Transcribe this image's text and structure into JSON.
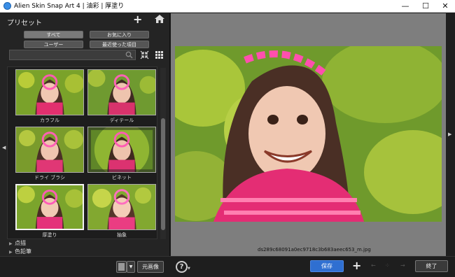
{
  "window": {
    "title": "Alien Skin Snap Art 4 | 油彩 | 厚塗り",
    "minimize": "—",
    "maximize": "☐",
    "close": "✕"
  },
  "presets": {
    "header": "プリセット",
    "add": "+",
    "filters": {
      "all": "すべて",
      "favorites": "お気に入り",
      "user": "ユーザー",
      "recent": "最近使った項目"
    },
    "search_placeholder": "",
    "items": [
      {
        "label": "カラフル"
      },
      {
        "label": "ディテール"
      },
      {
        "label": "ドライ ブラシ"
      },
      {
        "label": "ビネット"
      },
      {
        "label": "厚塗り"
      },
      {
        "label": "抽象"
      }
    ],
    "categories": [
      {
        "label": "点描"
      },
      {
        "label": "色鉛筆"
      }
    ]
  },
  "preview": {
    "filename": "ds289c68091a0ec9718c3b683aeec653_m.jpg"
  },
  "bottom": {
    "original_image": "元画像",
    "help": "?",
    "save": "保存",
    "plus": "+",
    "finish": "終了"
  },
  "colors": {
    "accent": "#2f6fd1",
    "panel": "#242424",
    "preview_bg": "#7e7e7e"
  }
}
